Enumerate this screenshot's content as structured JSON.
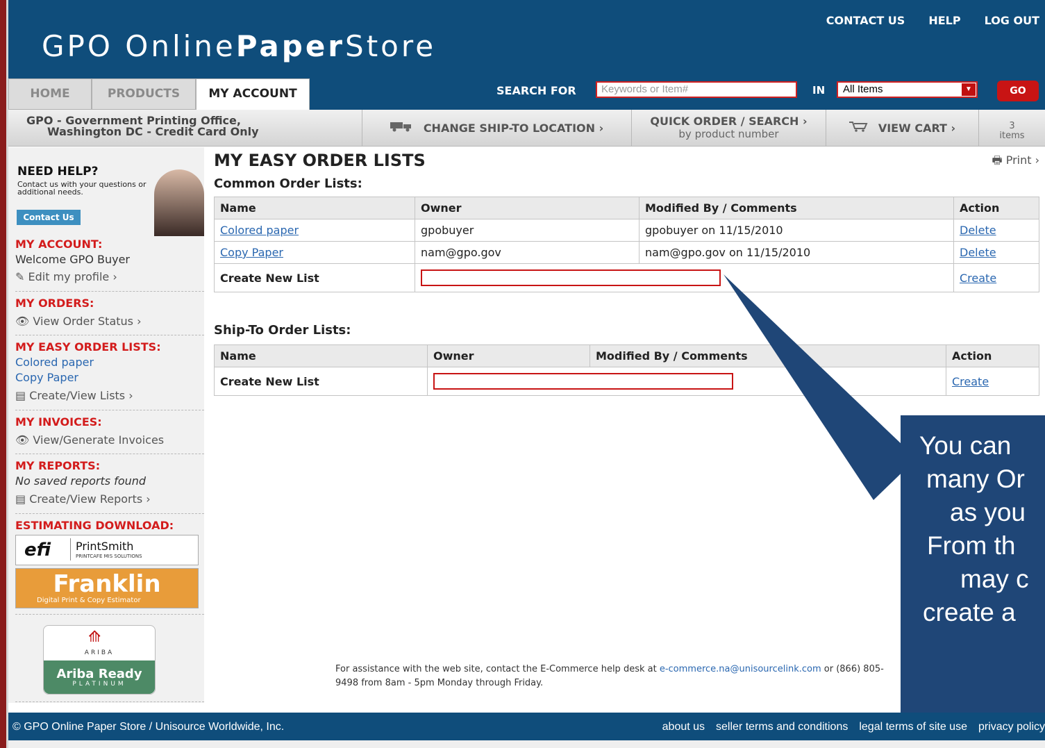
{
  "header": {
    "logo_light": "GPO Online",
    "logo_bold": "Paper",
    "logo_light2": "Store",
    "toplinks": [
      "CONTACT US",
      "HELP",
      "LOG OUT"
    ],
    "tabs": [
      "HOME",
      "PRODUCTS",
      "MY ACCOUNT"
    ],
    "search_label": "SEARCH FOR",
    "search_placeholder": "Keywords or Item#",
    "in_label": "IN",
    "category_value": "All Items",
    "go_label": "GO"
  },
  "subbar": {
    "org_line1": "GPO - Government Printing Office,",
    "org_line2": "Washington DC - Credit Card Only",
    "change_ship": "CHANGE SHIP-TO LOCATION ›",
    "quick_order": "QUICK ORDER / SEARCH ›",
    "quick_order_sub": "by product number",
    "view_cart": "VIEW CART ›",
    "cart_count": "3",
    "cart_items_label": "items"
  },
  "sidebar": {
    "need_help_title": "NEED HELP?",
    "need_help_text": "Contact us with your questions or additional needs.",
    "contact_button": "Contact Us",
    "my_account_heading": "MY ACCOUNT:",
    "welcome": "Welcome GPO Buyer",
    "edit_profile": "Edit my profile ›",
    "my_orders_heading": "MY ORDERS:",
    "view_order_status": "View Order Status ›",
    "easy_lists_heading": "MY EASY ORDER LISTS:",
    "list_links": [
      "Colored paper",
      "Copy Paper"
    ],
    "create_view_lists": "Create/View Lists ›",
    "invoices_heading": "MY INVOICES:",
    "view_invoices": "View/Generate Invoices",
    "reports_heading": "MY REPORTS:",
    "no_reports": "No saved reports found",
    "create_view_reports": "Create/View Reports ›",
    "estimating_heading": "ESTIMATING DOWNLOAD:",
    "efi_label": "efi",
    "printsmith_label": "PrintSmith",
    "printsmith_sub": "PRINTCAFE MIS SOLUTIONS",
    "franklin_label": "Franklin",
    "franklin_sub": "Digital Print & Copy Estimator",
    "ariba_label": "Ariba Ready",
    "ariba_top": "ARIBA",
    "ariba_sub": "PLATINUM"
  },
  "main": {
    "title": "MY EASY ORDER LISTS",
    "print": "Print ›",
    "common_heading": "Common Order Lists:",
    "common_columns": [
      "Name",
      "Owner",
      "Modified By / Comments",
      "Action"
    ],
    "common_rows": [
      {
        "name": "Colored paper",
        "owner": "gpobuyer",
        "modified": "gpobuyer on 11/15/2010",
        "action": "Delete"
      },
      {
        "name": "Copy Paper",
        "owner": "nam@gpo.gov",
        "modified": "nam@gpo.gov on 11/15/2010",
        "action": "Delete"
      }
    ],
    "create_new_list": "Create New List",
    "create_action": "Create",
    "shipto_heading": "Ship-To Order Lists:",
    "shipto_columns": [
      "Name",
      "Owner",
      "Modified By / Comments",
      "Action"
    ]
  },
  "footnote": {
    "text_before": "For assistance with the web site, contact the E-Commerce help desk at ",
    "email": "e-commerce.na@unisourcelink.com",
    "text_after": " or (866) 805-9498 from 8am - 5pm Monday through Friday."
  },
  "callout": {
    "lines": [
      "You can",
      "many Or",
      "as you",
      "From th",
      "may c",
      "create a"
    ]
  },
  "footer": {
    "copyright": "© GPO Online Paper Store / Unisource Worldwide, Inc.",
    "links": [
      "about us",
      "seller terms and conditions",
      "legal terms of site use",
      "privacy policy"
    ]
  },
  "colors": {
    "header_blue": "#0f4d7b",
    "accent_red": "#d31c1c",
    "link_blue": "#2a67b0",
    "callout_blue": "#1f4677"
  }
}
